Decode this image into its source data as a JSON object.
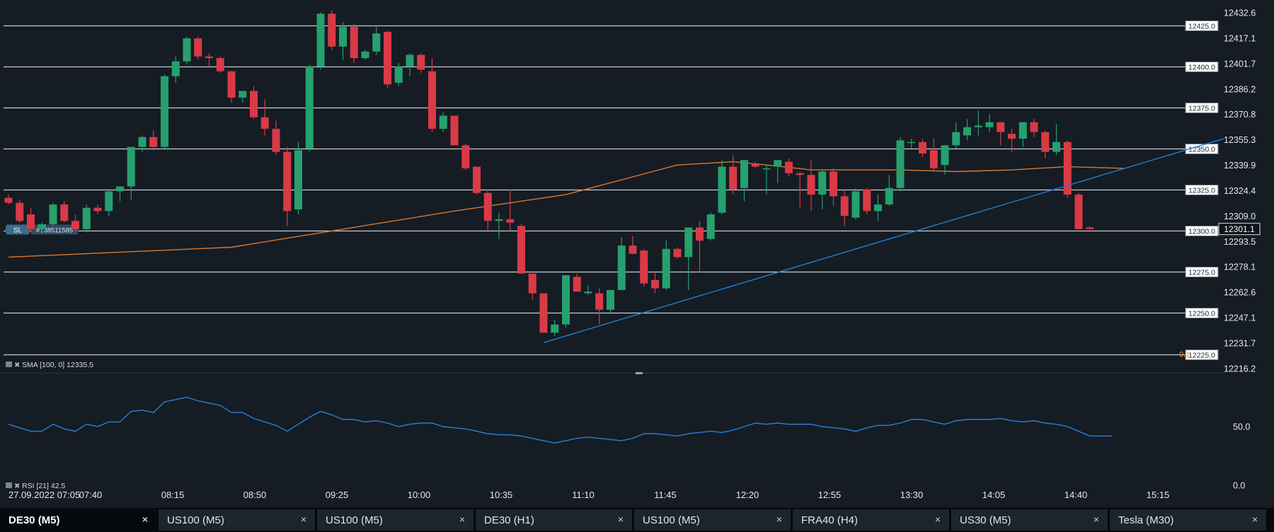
{
  "chart_data": [
    {
      "type": "candlestick",
      "title": "",
      "instrument": "DE30 (M5)",
      "ylim": [
        12210,
        12440
      ],
      "y_ticks": [
        "12432.6",
        "12417.1",
        "12401.7",
        "12386.2",
        "12370.8",
        "12355.3",
        "12339.9",
        "12324.4",
        "12309.0",
        "12293.5",
        "12278.1",
        "12262.6",
        "12247.1",
        "12231.7",
        "12216.2"
      ],
      "y_tick_values": [
        12432.6,
        12417.1,
        12401.7,
        12386.2,
        12370.8,
        12355.3,
        12339.9,
        12324.4,
        12309.0,
        12293.5,
        12278.1,
        12262.6,
        12247.1,
        12231.7,
        12216.2
      ],
      "x_ticks": [
        "27.09.2022 07:05",
        "07:40",
        "08:15",
        "08:50",
        "09:25",
        "10:00",
        "10:35",
        "11:10",
        "11:45",
        "12:20",
        "12:55",
        "13:30",
        "14:05",
        "14:40",
        "15:15"
      ],
      "horizontal_levels": [
        {
          "label": "12425.0",
          "value": 12425.0
        },
        {
          "label": "12400.0",
          "value": 12400.0
        },
        {
          "label": "12375.0",
          "value": 12375.0
        },
        {
          "label": "12350.0",
          "value": 12350.0
        },
        {
          "label": "12325.0",
          "value": 12325.0
        },
        {
          "label": "12300.0",
          "value": 12300.0
        },
        {
          "label": "12275.0",
          "value": 12275.0
        },
        {
          "label": "12250.0",
          "value": 12250.0
        },
        {
          "label": "12225.0",
          "value": 12225.0
        }
      ],
      "current_price": {
        "label": "12301.1",
        "value": 12301.1
      },
      "sl_marker": {
        "tag": "SL",
        "id": "#738511585",
        "value": 12301.0
      },
      "extra_label": {
        "text": "0.1",
        "color": "#e89a3a"
      },
      "candles": [
        {
          "o": 12320,
          "h": 12322,
          "l": 12316,
          "c": 12317
        },
        {
          "o": 12317,
          "h": 12319,
          "l": 12305,
          "c": 12306
        },
        {
          "o": 12310,
          "h": 12314,
          "l": 12299,
          "c": 12301
        },
        {
          "o": 12301,
          "h": 12305,
          "l": 12298,
          "c": 12304
        },
        {
          "o": 12304,
          "h": 12317,
          "l": 12303,
          "c": 12316
        },
        {
          "o": 12316,
          "h": 12318,
          "l": 12305,
          "c": 12306
        },
        {
          "o": 12306,
          "h": 12310,
          "l": 12299,
          "c": 12301
        },
        {
          "o": 12301,
          "h": 12316,
          "l": 12299,
          "c": 12314
        },
        {
          "o": 12314,
          "h": 12316,
          "l": 12310,
          "c": 12312
        },
        {
          "o": 12312,
          "h": 12324,
          "l": 12309,
          "c": 12324
        },
        {
          "o": 12324,
          "h": 12327,
          "l": 12318,
          "c": 12327
        },
        {
          "o": 12327,
          "h": 12332,
          "l": 12319,
          "c": 12351
        },
        {
          "o": 12351,
          "h": 12358,
          "l": 12348,
          "c": 12357
        },
        {
          "o": 12357,
          "h": 12361,
          "l": 12349,
          "c": 12351
        },
        {
          "o": 12351,
          "h": 12395,
          "l": 12350,
          "c": 12394
        },
        {
          "o": 12394,
          "h": 12406,
          "l": 12390,
          "c": 12403
        },
        {
          "o": 12403,
          "h": 12418,
          "l": 12401,
          "c": 12417
        },
        {
          "o": 12417,
          "h": 12418,
          "l": 12404,
          "c": 12406
        },
        {
          "o": 12406,
          "h": 12408,
          "l": 12399,
          "c": 12405
        },
        {
          "o": 12405,
          "h": 12406,
          "l": 12396,
          "c": 12397
        },
        {
          "o": 12397,
          "h": 12397,
          "l": 12378,
          "c": 12381
        },
        {
          "o": 12381,
          "h": 12385,
          "l": 12378,
          "c": 12385
        },
        {
          "o": 12385,
          "h": 12388,
          "l": 12368,
          "c": 12369
        },
        {
          "o": 12369,
          "h": 12380,
          "l": 12358,
          "c": 12362
        },
        {
          "o": 12362,
          "h": 12367,
          "l": 12346,
          "c": 12348
        },
        {
          "o": 12348,
          "h": 12351,
          "l": 12303,
          "c": 12312
        },
        {
          "o": 12313,
          "h": 12354,
          "l": 12310,
          "c": 12349
        },
        {
          "o": 12350,
          "h": 12401,
          "l": 12348,
          "c": 12400
        },
        {
          "o": 12400,
          "h": 12433,
          "l": 12398,
          "c": 12432
        },
        {
          "o": 12432,
          "h": 12434,
          "l": 12410,
          "c": 12412
        },
        {
          "o": 12412,
          "h": 12427,
          "l": 12404,
          "c": 12424
        },
        {
          "o": 12424,
          "h": 12426,
          "l": 12402,
          "c": 12405
        },
        {
          "o": 12405,
          "h": 12410,
          "l": 12404,
          "c": 12409
        },
        {
          "o": 12409,
          "h": 12424,
          "l": 12407,
          "c": 12420
        },
        {
          "o": 12421,
          "h": 12422,
          "l": 12387,
          "c": 12389
        },
        {
          "o": 12390,
          "h": 12402,
          "l": 12388,
          "c": 12400
        },
        {
          "o": 12400,
          "h": 12408,
          "l": 12394,
          "c": 12407
        },
        {
          "o": 12407,
          "h": 12408,
          "l": 12396,
          "c": 12398
        },
        {
          "o": 12397,
          "h": 12405,
          "l": 12360,
          "c": 12362
        },
        {
          "o": 12362,
          "h": 12372,
          "l": 12360,
          "c": 12370
        },
        {
          "o": 12370,
          "h": 12370,
          "l": 12352,
          "c": 12352
        },
        {
          "o": 12352,
          "h": 12353,
          "l": 12337,
          "c": 12338
        },
        {
          "o": 12339,
          "h": 12339,
          "l": 12322,
          "c": 12323
        },
        {
          "o": 12323,
          "h": 12325,
          "l": 12300,
          "c": 12306
        },
        {
          "o": 12306,
          "h": 12311,
          "l": 12295,
          "c": 12307
        },
        {
          "o": 12307,
          "h": 12325,
          "l": 12300,
          "c": 12305
        },
        {
          "o": 12303,
          "h": 12304,
          "l": 12274,
          "c": 12274
        },
        {
          "o": 12274,
          "h": 12274,
          "l": 12258,
          "c": 12262
        },
        {
          "o": 12262,
          "h": 12262,
          "l": 12239,
          "c": 12238
        },
        {
          "o": 12238,
          "h": 12246,
          "l": 12236,
          "c": 12243
        },
        {
          "o": 12243,
          "h": 12273,
          "l": 12241,
          "c": 12273
        },
        {
          "o": 12272,
          "h": 12274,
          "l": 12263,
          "c": 12263
        },
        {
          "o": 12262,
          "h": 12267,
          "l": 12261,
          "c": 12263
        },
        {
          "o": 12262,
          "h": 12265,
          "l": 12243,
          "c": 12252
        },
        {
          "o": 12252,
          "h": 12264,
          "l": 12250,
          "c": 12264
        },
        {
          "o": 12264,
          "h": 12296,
          "l": 12264,
          "c": 12291
        },
        {
          "o": 12291,
          "h": 12297,
          "l": 12286,
          "c": 12286
        },
        {
          "o": 12288,
          "h": 12289,
          "l": 12266,
          "c": 12268
        },
        {
          "o": 12270,
          "h": 12275,
          "l": 12262,
          "c": 12265
        },
        {
          "o": 12265,
          "h": 12294,
          "l": 12264,
          "c": 12289
        },
        {
          "o": 12289,
          "h": 12290,
          "l": 12283,
          "c": 12284
        },
        {
          "o": 12284,
          "h": 12302,
          "l": 12264,
          "c": 12302
        },
        {
          "o": 12302,
          "h": 12306,
          "l": 12275,
          "c": 12294
        },
        {
          "o": 12295,
          "h": 12311,
          "l": 12294,
          "c": 12310
        },
        {
          "o": 12311,
          "h": 12343,
          "l": 12310,
          "c": 12339
        },
        {
          "o": 12339,
          "h": 12346,
          "l": 12322,
          "c": 12325
        },
        {
          "o": 12326,
          "h": 12343,
          "l": 12318,
          "c": 12343
        },
        {
          "o": 12341,
          "h": 12342,
          "l": 12338,
          "c": 12339
        },
        {
          "o": 12338,
          "h": 12340,
          "l": 12322,
          "c": 12338
        },
        {
          "o": 12339,
          "h": 12343,
          "l": 12329,
          "c": 12343
        },
        {
          "o": 12342,
          "h": 12344,
          "l": 12333,
          "c": 12335
        },
        {
          "o": 12335,
          "h": 12336,
          "l": 12314,
          "c": 12334
        },
        {
          "o": 12334,
          "h": 12343,
          "l": 12312,
          "c": 12322
        },
        {
          "o": 12322,
          "h": 12337,
          "l": 12313,
          "c": 12336
        },
        {
          "o": 12336,
          "h": 12338,
          "l": 12315,
          "c": 12321
        },
        {
          "o": 12321,
          "h": 12325,
          "l": 12303,
          "c": 12309
        },
        {
          "o": 12308,
          "h": 12326,
          "l": 12307,
          "c": 12324
        },
        {
          "o": 12325,
          "h": 12326,
          "l": 12310,
          "c": 12312
        },
        {
          "o": 12312,
          "h": 12322,
          "l": 12306,
          "c": 12316
        },
        {
          "o": 12316,
          "h": 12334,
          "l": 12315,
          "c": 12326
        },
        {
          "o": 12326,
          "h": 12357,
          "l": 12324,
          "c": 12355
        },
        {
          "o": 12354,
          "h": 12356,
          "l": 12350,
          "c": 12354
        },
        {
          "o": 12354,
          "h": 12356,
          "l": 12345,
          "c": 12347
        },
        {
          "o": 12349,
          "h": 12356,
          "l": 12336,
          "c": 12338
        },
        {
          "o": 12340,
          "h": 12352,
          "l": 12334,
          "c": 12352
        },
        {
          "o": 12352,
          "h": 12366,
          "l": 12350,
          "c": 12360
        },
        {
          "o": 12358,
          "h": 12368,
          "l": 12355,
          "c": 12363
        },
        {
          "o": 12363,
          "h": 12373,
          "l": 12358,
          "c": 12364
        },
        {
          "o": 12363,
          "h": 12371,
          "l": 12360,
          "c": 12366
        },
        {
          "o": 12366,
          "h": 12366,
          "l": 12352,
          "c": 12360
        },
        {
          "o": 12359,
          "h": 12362,
          "l": 12348,
          "c": 12356
        },
        {
          "o": 12356,
          "h": 12366,
          "l": 12351,
          "c": 12366
        },
        {
          "o": 12366,
          "h": 12368,
          "l": 12357,
          "c": 12360
        },
        {
          "o": 12360,
          "h": 12361,
          "l": 12344,
          "c": 12348
        },
        {
          "o": 12348,
          "h": 12365,
          "l": 12346,
          "c": 12354
        },
        {
          "o": 12354,
          "h": 12355,
          "l": 12320,
          "c": 12322
        },
        {
          "o": 12322,
          "h": 12323,
          "l": 12301,
          "c": 12301
        },
        {
          "o": 12302,
          "h": 12303,
          "l": 12301,
          "c": 12301
        }
      ],
      "sma": {
        "name": "SMA [100, 0] 12335.5",
        "color": "#d9782f",
        "values": [
          [
            0,
            12284
          ],
          [
            20,
            12290
          ],
          [
            40,
            12312
          ],
          [
            50,
            12322
          ],
          [
            55,
            12331
          ],
          [
            60,
            12340
          ],
          [
            65,
            12342
          ],
          [
            68,
            12340
          ],
          [
            72,
            12337
          ],
          [
            80,
            12337
          ],
          [
            85,
            12336
          ],
          [
            90,
            12337
          ],
          [
            95,
            12339
          ],
          [
            100,
            12338
          ]
        ]
      },
      "trendline": {
        "color": "#1f7fd8",
        "start": [
          48,
          12232
        ],
        "end": [
          109,
          12356
        ]
      }
    },
    {
      "type": "line",
      "title": "",
      "indicator": "RSI [21] 42.5",
      "ylim": [
        0,
        78
      ],
      "y_ticks": [
        "50.0",
        "0.0"
      ],
      "y_tick_values": [
        50,
        0
      ],
      "color": "#2a7fd6",
      "values": [
        52,
        49,
        46,
        46,
        52,
        48,
        46,
        52,
        50,
        54,
        54,
        63,
        64,
        62,
        71,
        73,
        75,
        72,
        70,
        68,
        62,
        62,
        57,
        54,
        51,
        46,
        52,
        58,
        63,
        60,
        56,
        56,
        54,
        55,
        53,
        50,
        52,
        53,
        53,
        50,
        49,
        48,
        46,
        44,
        43,
        43,
        42,
        40,
        38,
        36,
        38,
        40,
        41,
        40,
        39,
        38,
        40,
        44,
        44,
        43,
        42,
        44,
        45,
        46,
        45,
        47,
        50,
        53,
        52,
        53,
        52,
        52,
        52,
        50,
        49,
        48,
        46,
        49,
        51,
        51,
        53,
        56,
        56,
        54,
        52,
        55,
        56,
        56,
        56,
        57,
        55,
        54,
        55,
        53,
        52,
        50,
        46,
        42,
        42,
        42
      ]
    }
  ],
  "tabs": [
    {
      "label": "DE30 (M5)",
      "close": "×",
      "active": true
    },
    {
      "label": "US100 (M5)",
      "close": "×",
      "active": false
    },
    {
      "label": "US100 (M5)",
      "close": "×",
      "active": false
    },
    {
      "label": "DE30 (H1)",
      "close": "×",
      "active": false
    },
    {
      "label": "US100 (M5)",
      "close": "×",
      "active": false
    },
    {
      "label": "FRA40 (H4)",
      "close": "×",
      "active": false
    },
    {
      "label": "US30 (M5)",
      "close": "×",
      "active": false
    },
    {
      "label": "Tesla (M30)",
      "close": "×",
      "active": false
    }
  ],
  "colors": {
    "background": "#151c24",
    "bull": "#26a06e",
    "bear": "#d93a46",
    "level_line": "#c8ccd2",
    "axis_text": "#e6e9ed"
  }
}
